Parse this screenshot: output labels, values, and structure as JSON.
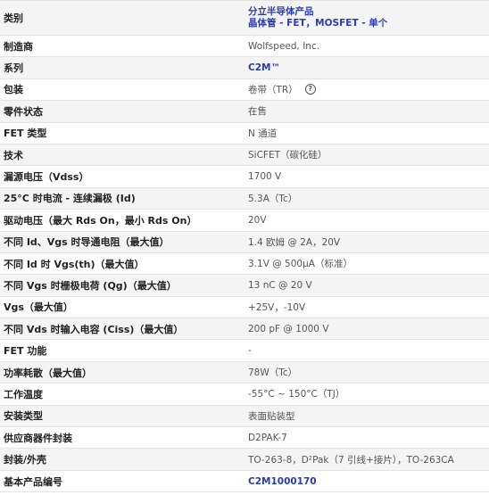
{
  "rows": [
    {
      "label": "类别",
      "value_lines": [
        "分立半导体产品",
        "晶体管 - FET，MOSFET - 单个"
      ]
    },
    {
      "label": "制造商",
      "value": "Wolfspeed, Inc."
    },
    {
      "label": "系列",
      "value": "C2M™"
    },
    {
      "label": "包装",
      "value": "卷带（TR）",
      "icon": "help-circle-icon"
    },
    {
      "label": "零件状态",
      "value": "在售"
    },
    {
      "label": "FET 类型",
      "value": "N 通道"
    },
    {
      "label": "技术",
      "value": "SiCFET（碳化硅）"
    },
    {
      "label": "漏源电压（Vdss）",
      "value": "1700 V"
    },
    {
      "label": "25°C 时电流 - 连续漏极 (Id)",
      "value": "5.3A（Tc）"
    },
    {
      "label": "驱动电压（最大 Rds On，最小 Rds On）",
      "value": "20V"
    },
    {
      "label": "不同 Id、Vgs 时导通电阻（最大值）",
      "value": "1.4 欧姆 @ 2A，20V"
    },
    {
      "label": "不同 Id 时 Vgs(th)（最大值）",
      "value": "3.1V @ 500µA（标准）"
    },
    {
      "label": "不同 Vgs 时栅极电荷 (Qg)（最大值）",
      "value": "13 nC @ 20 V"
    },
    {
      "label": "Vgs（最大值）",
      "value": "+25V，-10V"
    },
    {
      "label": "不同 Vds 时输入电容 (Ciss)（最大值）",
      "value": "200 pF @ 1000 V"
    },
    {
      "label": "FET 功能",
      "value": "-"
    },
    {
      "label": "功率耗散（最大值）",
      "value": "78W（Tc）"
    },
    {
      "label": "工作温度",
      "value": "-55°C ~ 150°C（TJ）"
    },
    {
      "label": "安装类型",
      "value": "表面贴装型"
    },
    {
      "label": "供应商器件封装",
      "value": "D2PAK-7"
    },
    {
      "label": "封装/外壳",
      "value": "TO-263-8，D²Pak（7 引线+接片），TO-263CA"
    },
    {
      "label": "基本产品编号",
      "value": "C2M1000170"
    }
  ],
  "colors": {
    "link": "#2a3bb7",
    "border": "#e3e3e3",
    "stripe": "#f4f4f4"
  }
}
